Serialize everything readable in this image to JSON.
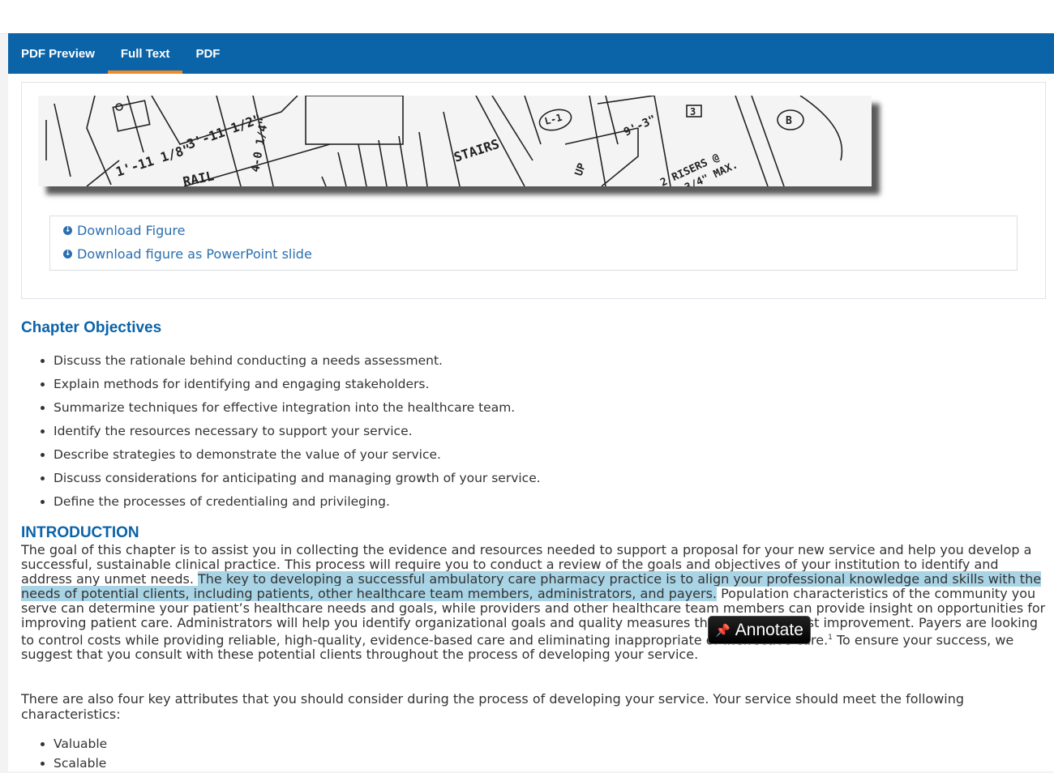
{
  "nav": {
    "tabs": [
      {
        "label": "PDF Preview"
      },
      {
        "label": "Full Text"
      },
      {
        "label": "PDF"
      }
    ],
    "active_tab": "Full Text"
  },
  "figure": {
    "downloads": [
      {
        "label": "Download Figure"
      },
      {
        "label": "Download figure as PowerPoint slide"
      }
    ],
    "sketch_labels": [
      "STAIRS",
      "L-1",
      "B",
      "3",
      "9'-3\"",
      "3'-11 1/2\"",
      "1'-11 1/8\"",
      "4-0 1/4\"",
      "UP",
      "2 RISERS @",
      "3/4\" MAX.",
      "RAIL"
    ]
  },
  "objectives": {
    "heading": "Chapter Objectives",
    "items": [
      "Discuss the rationale behind conducting a needs assessment.",
      "Explain methods for identifying and engaging stakeholders.",
      "Summarize techniques for effective integration into the healthcare team.",
      "Identify the resources necessary to support your service.",
      "Describe strategies to demonstrate the value of your service.",
      "Discuss considerations for anticipating and managing growth of your service.",
      "Define the processes of credentialing and privileging."
    ]
  },
  "introduction": {
    "heading": "INTRODUCTION",
    "text_before": "The goal of this chapter is to assist you in collecting the evidence and resources needed to support a proposal for your new service and help you develop a successful, sustainable clinical practice. This process will require you to conduct a review of the goals and objectives of your institution to identify and address any unmet needs. ",
    "highlighted": "The key to developing a successful ambulatory care pharmacy practice is to align your professional knowledge and skills with the needs of potential clients, including patients, other healthcare team members, administrators, and payers.",
    "text_after": " Population characteristics of the community you serve can determine your patient’s healthcare needs and goals, while providers and other healthcare team members can provide insight on opportunities for improving patient care. Administrators will help you identify organizational goals and quality measures that need the most improvement. Payers are looking to control costs while providing reliable, high-quality, evidence-based care and eliminating inappropriate or ineffective care.",
    "footnote": "1",
    "text_end": " To ensure your success, we suggest that you consult with these potential clients throughout the process of developing your service.",
    "paragraph2": "There are also four key attributes that you should consider during the process of developing your service. Your service should meet the following characteristics:",
    "attributes": [
      "Valuable",
      "Scalable"
    ]
  },
  "annotate": {
    "label": "Annotate",
    "icon": "pushpin-icon"
  },
  "colors": {
    "nav_bg": "#0b63a8",
    "active_tab_underline": "#f08a24",
    "link": "#2a6fb0",
    "heading": "#0b63a8",
    "highlight": "#a8d4e6"
  }
}
